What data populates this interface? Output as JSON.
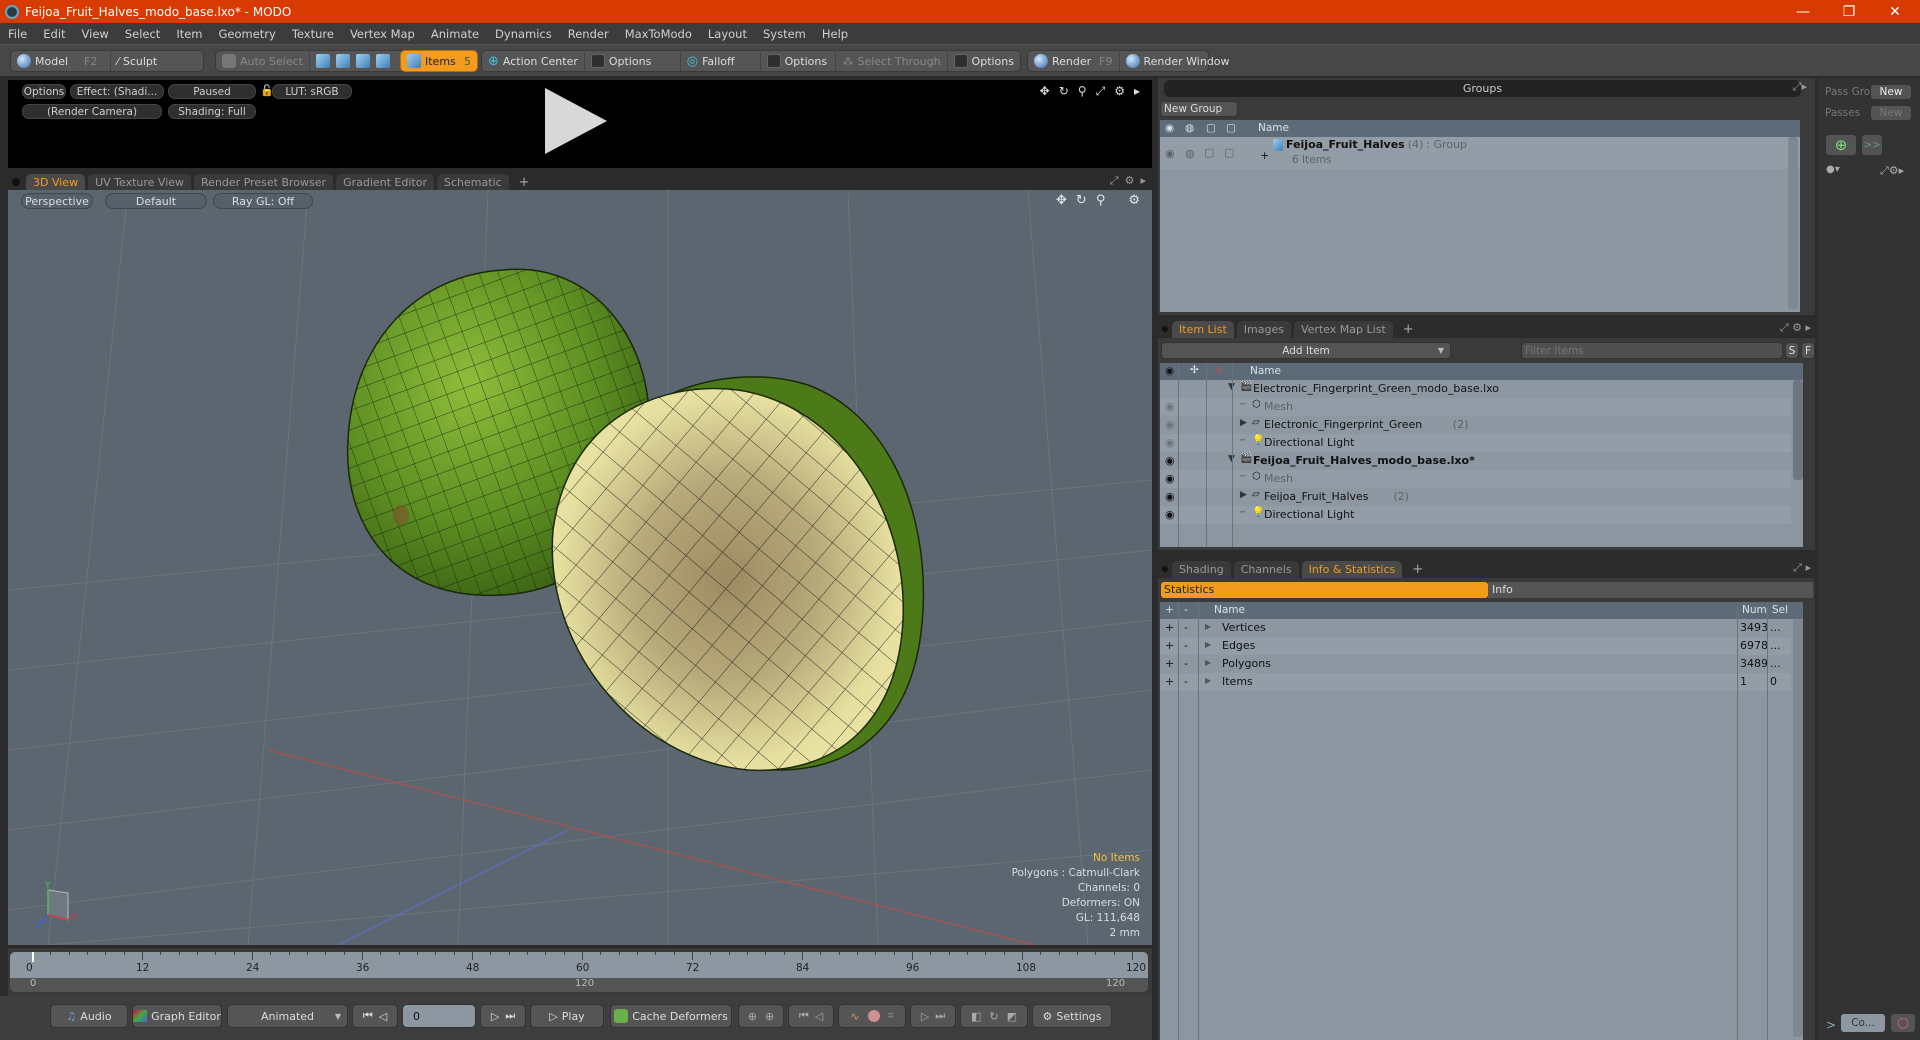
{
  "window": {
    "title": "Feijoa_Fruit_Halves_modo_base.lxo* - MODO",
    "minimize_icon": "—",
    "restore_icon": "❐",
    "close_icon": "✕"
  },
  "menu": [
    "File",
    "Edit",
    "View",
    "Select",
    "Item",
    "Geometry",
    "Texture",
    "Vertex Map",
    "Animate",
    "Dynamics",
    "Render",
    "MaxToModo",
    "Layout",
    "System",
    "Help"
  ],
  "toolbar": {
    "model": "Model",
    "model_key": "F2",
    "sculpt": "Sculpt",
    "auto_select": "Auto Select",
    "items": "Items",
    "items_count": "5",
    "action_center": "Action Center",
    "options1": "Options",
    "falloff": "Falloff",
    "options2": "Options",
    "select_through": "Select Through",
    "options3": "Options",
    "render": "Render",
    "render_key": "F9",
    "render_window": "Render Window"
  },
  "preview": {
    "options": "Options",
    "effect": "Effect: (Shadi...",
    "paused": "Paused",
    "lut": "LUT: sRGB",
    "camera": "(Render Camera)",
    "shading": "Shading: Full",
    "play_icon": "▶"
  },
  "viewport_tabs": [
    "3D View",
    "UV Texture View",
    "Render Preset Browser",
    "Gradient Editor",
    "Schematic"
  ],
  "viewport": {
    "perspective": "Perspective",
    "default": "Default",
    "raygl": "Ray GL: Off",
    "overlay": {
      "status": "No Items",
      "polygons": "Polygons : Catmull-Clark",
      "channels": "Channels: 0",
      "deformers": "Deformers: ON",
      "gl": "GL: 111,648",
      "scale": "2 mm"
    },
    "axis": {
      "x": "X",
      "y": "Y",
      "z": "Z"
    }
  },
  "timeline": {
    "ticks": [
      "0",
      "12",
      "24",
      "36",
      "48",
      "60",
      "72",
      "84",
      "96",
      "108",
      "120"
    ],
    "range_start": "0",
    "range_mid": "120",
    "range_end": "120",
    "current_frame": 0,
    "max_frame": 120
  },
  "bottombar": {
    "audio": "Audio",
    "graph_editor": "Graph Editor",
    "animated": "Animated",
    "frame": "0",
    "play": "Play",
    "cache_deformers": "Cache Deformers",
    "settings": "Settings"
  },
  "groups": {
    "title": "Groups",
    "new_group": "New Group",
    "col_name": "Name",
    "row": {
      "name": "Feijoa_Fruit_Halves",
      "count": "(4)",
      "type": ": Group",
      "sub": "6 Items"
    }
  },
  "passes": {
    "pass_groups": "Pass Gro",
    "passes": "Passes",
    "new1": "New",
    "new2": "New",
    "more": ">>",
    "command": "Co..."
  },
  "item_list": {
    "tabs": [
      "Item List",
      "Images",
      "Vertex Map List"
    ],
    "add_item": "Add Item",
    "filter_placeholder": "Filter Items",
    "s": "S",
    "f": "F",
    "col_name": "Name",
    "rows": [
      {
        "name": "Electronic_Fingerprint_Green_modo_base.lxo",
        "type": "scene",
        "level": 0,
        "count": "",
        "bold": false,
        "dim": false
      },
      {
        "name": "Mesh",
        "type": "mesh",
        "level": 1,
        "count": "",
        "bold": false,
        "dim": true
      },
      {
        "name": "Electronic_Fingerprint_Green",
        "type": "group",
        "level": 1,
        "count": "(2)",
        "bold": false,
        "dim": false
      },
      {
        "name": "Directional Light",
        "type": "light",
        "level": 1,
        "count": "",
        "bold": false,
        "dim": false
      },
      {
        "name": "Feijoa_Fruit_Halves_modo_base.lxo*",
        "type": "scene",
        "level": 0,
        "count": "",
        "bold": true,
        "dim": false
      },
      {
        "name": "Mesh",
        "type": "mesh",
        "level": 1,
        "count": "",
        "bold": false,
        "dim": true
      },
      {
        "name": "Feijoa_Fruit_Halves",
        "type": "group",
        "level": 1,
        "count": "(2)",
        "bold": false,
        "dim": false
      },
      {
        "name": "Directional Light",
        "type": "light",
        "level": 1,
        "count": "",
        "bold": false,
        "dim": false
      }
    ]
  },
  "info": {
    "tabs": [
      "Shading",
      "Channels",
      "Info & Statistics"
    ],
    "statistics": "Statistics",
    "info": "Info",
    "cols": {
      "plus": "+",
      "minus": "-",
      "name": "Name",
      "num": "Num",
      "sel": "Sel"
    },
    "rows": [
      {
        "name": "Vertices",
        "num": "3493",
        "sel": "..."
      },
      {
        "name": "Edges",
        "num": "6978",
        "sel": "..."
      },
      {
        "name": "Polygons",
        "num": "3489",
        "sel": "..."
      },
      {
        "name": "Items",
        "num": "1",
        "sel": "0"
      }
    ]
  },
  "colors": {
    "accent": "#f29b1d",
    "titlebar": "#d83b01",
    "viewport_bg": "#5c6670"
  }
}
